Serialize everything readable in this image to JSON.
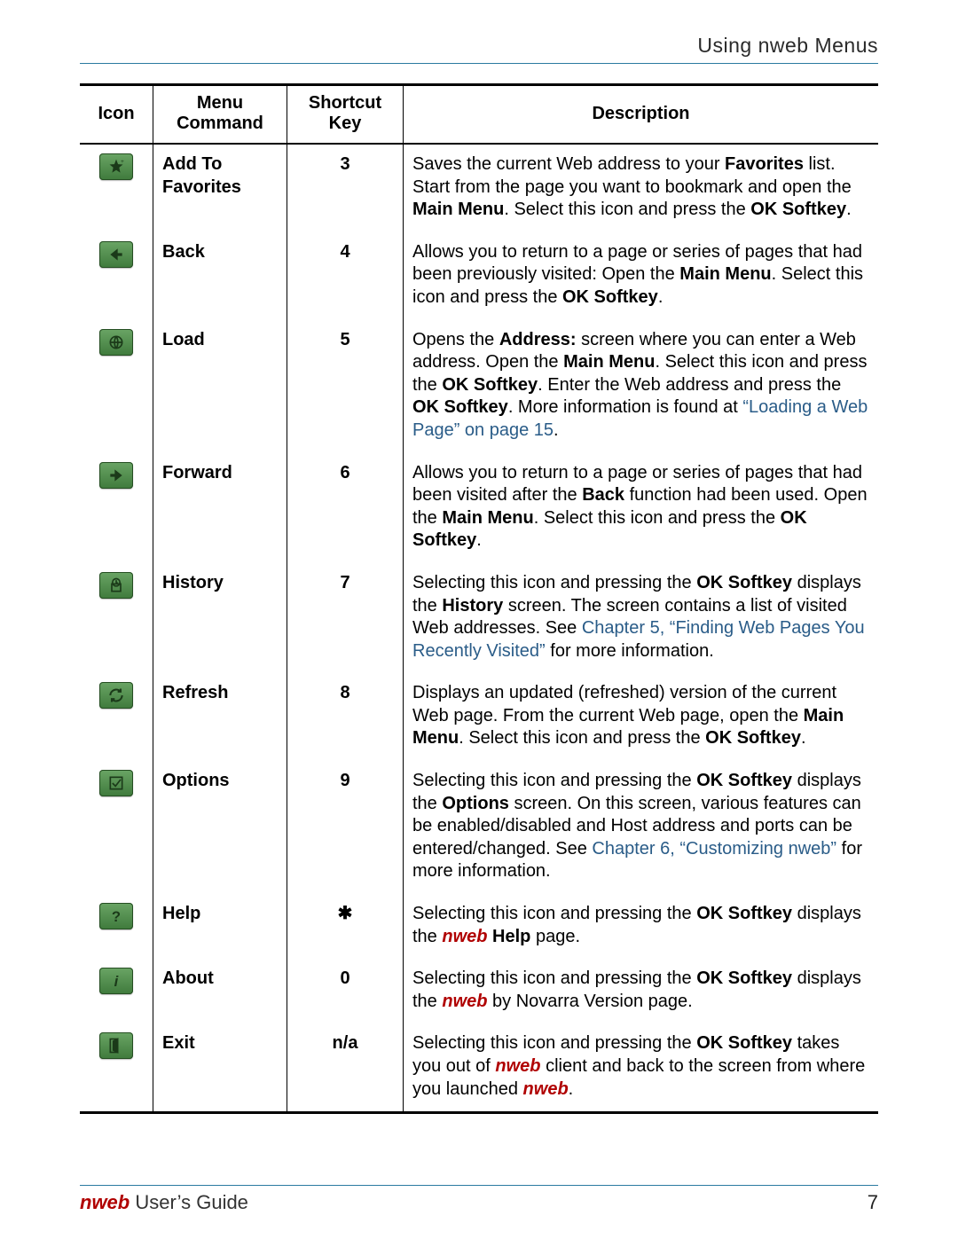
{
  "header": {
    "text": "Using nweb Menus"
  },
  "columns": {
    "icon": "Icon",
    "command": "Menu Command",
    "key": "Shortcut Key",
    "desc": "Description"
  },
  "rows": [
    {
      "icon": "favorites-icon",
      "command": "Add To Favorites",
      "key": "3",
      "desc": "Saves the current Web address to your <b>Favorites</b> list. Start from the page you want to bookmark and open the <b>Main Menu</b>. Select this icon and press the <b>OK Softkey</b>."
    },
    {
      "icon": "back-icon",
      "command": "Back",
      "key": "4",
      "desc": "Allows you to return to a page or series of pages that had been previously visited: Open the <b>Main Menu</b>. Select this icon and press the <b>OK Softkey</b>."
    },
    {
      "icon": "load-icon",
      "command": "Load",
      "key": "5",
      "desc": "Opens the <b>Address:</b> screen where you can enter a Web address. Open the <b>Main Menu</b>. Select this icon and press the <b>OK Softkey</b>. Enter the Web address and press the <b>OK Softkey</b>. More information is found at <span class=\"link\">“Loading a Web Page” on page 15</span>."
    },
    {
      "icon": "forward-icon",
      "command": "Forward",
      "key": "6",
      "desc": "Allows you to return to a page or series of pages that had been visited after the <b>Back</b> function had been used. Open the <b>Main Menu</b>. Select this icon and press the <b>OK Softkey</b>."
    },
    {
      "icon": "history-icon",
      "command": "History",
      "key": "7",
      "desc": "Selecting this icon and pressing the <b>OK Softkey</b> displays the <b>History</b> screen. The screen contains a list of visited Web addresses. See <span class=\"link\">Chapter 5, “Finding Web Pages You Recently Visited”</span> for more information."
    },
    {
      "icon": "refresh-icon",
      "command": "Refresh",
      "key": "8",
      "desc": "Displays an updated (refreshed) version of the current Web page. From the current Web page, open the <b>Main Menu</b>. Select this icon and press the <b>OK Softkey</b>."
    },
    {
      "icon": "options-icon",
      "command": "Options",
      "key": "9",
      "desc": "Selecting this icon and pressing the <b>OK Softkey</b> displays the <b>Options</b> screen. On this screen, various features can be enabled/disabled and Host address and ports can be entered/changed. See <span class=\"link\">Chapter 6, “Customizing nweb”</span> for more information."
    },
    {
      "icon": "help-icon",
      "command": "Help",
      "key": "✱",
      "desc": "Selecting this icon and pressing the <b>OK Softkey</b> displays the <span class=\"nweb\">nweb</span> <b>Help</b> page."
    },
    {
      "icon": "about-icon",
      "command": "About",
      "key": "0",
      "desc": "Selecting this icon and pressing the <b>OK Softkey</b> displays the <span class=\"nweb\">nweb</span> by Novarra Version page."
    },
    {
      "icon": "exit-icon",
      "command": "Exit",
      "key": "n/a",
      "desc": "Selecting this icon and pressing the <b>OK Softkey</b> takes you out of <span class=\"nweb\">nweb</span> client and back to the screen from where you launched <span class=\"nweb\">nweb</span>."
    }
  ],
  "footer": {
    "title_prefix": "nweb",
    "title_rest": " User’s Guide",
    "page": "7"
  },
  "iconGlyphs": {
    "favorites-icon": "<svg viewBox='0 0 24 24' fill='#1b3a19'><polygon points='12,2 14.5,8.5 21,9 16,13 17.5,20 12,16.5 6.5,20 8,13 3,9 9.5,8.5'/><text x='18' y='7' font-size='8' fill='#1b3a19'>+</text></svg>",
    "back-icon": "<svg viewBox='0 0 24 24' fill='#1b3a19'><polygon points='14,4 4,12 14,20 14,14 20,14 20,10 14,10'/></svg>",
    "load-icon": "<svg viewBox='0 0 24 24' fill='none' stroke='#1b3a19' stroke-width='2'><circle cx='12' cy='12' r='8'/><path d='M4 12h16M12 4c3 4 3 12 0 16M12 4c-3 4-3 12 0 16'/></svg>",
    "forward-icon": "<svg viewBox='0 0 24 24' fill='#1b3a19'><polygon points='10,4 20,12 10,20 10,14 4,14 4,10 10,10'/></svg>",
    "history-icon": "<svg viewBox='0 0 24 24' fill='none' stroke='#1b3a19' stroke-width='2'><rect x='6' y='10' width='12' height='10'/><circle cx='12' cy='8' r='5'/><path d='M12 5v3l2 1'/></svg>",
    "refresh-icon": "<svg viewBox='0 0 24 24' fill='none' stroke='#1b3a19' stroke-width='2.5'><path d='M4 12a8 8 0 0 1 14-5'/><polyline points='18 3 18 7 14 7' fill='#1b3a19'/><path d='M20 12a8 8 0 0 1-14 5'/><polyline points='6 21 6 17 10 17' fill='#1b3a19'/></svg>",
    "options-icon": "<svg viewBox='0 0 24 24' fill='none' stroke='#1b3a19' stroke-width='2'><rect x='4' y='4' width='16' height='16'/><polyline points='7 12 11 16 18 7'/></svg>",
    "help-icon": "<svg viewBox='0 0 24 24' fill='#1b3a19'><text x='12' y='19' font-size='20' text-anchor='middle' font-weight='bold'>?</text></svg>",
    "about-icon": "<svg viewBox='0 0 24 24' fill='#1b3a19'><text x='12' y='19' font-size='20' text-anchor='middle' font-weight='bold' font-style='italic'>i</text></svg>",
    "exit-icon": "<svg viewBox='0 0 24 24' fill='none' stroke='#1b3a19' stroke-width='2'><rect x='4' y='3' width='10' height='18'/><polygon points='14 3 14 21 8 18 8 6' fill='#1b3a19'/></svg>"
  }
}
